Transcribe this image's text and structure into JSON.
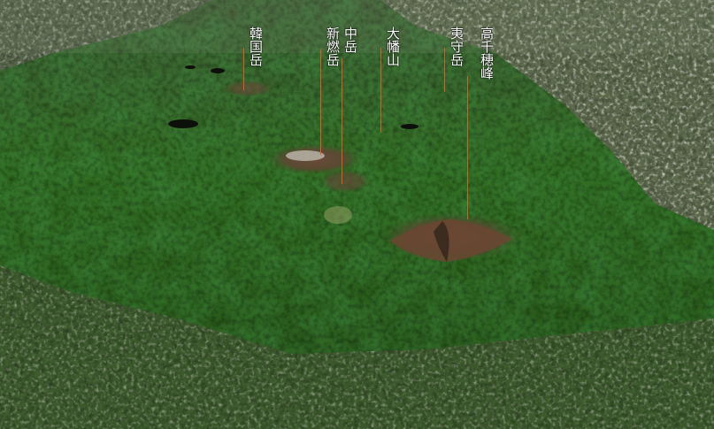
{
  "map": {
    "imagery": "satellite-3d-terrain",
    "colors": {
      "leader_line": "#e25a1c",
      "label_text": "#ffffff",
      "vegetation": "#2f6a1f",
      "urban": "#a8a89a"
    },
    "peaks": [
      {
        "id": "karakunidake",
        "name": "韓国岳"
      },
      {
        "id": "shinmoedake",
        "name": "新燃岳"
      },
      {
        "id": "nakadake",
        "name": "中岳"
      },
      {
        "id": "ohatayama",
        "name": "大幡山"
      },
      {
        "id": "ehinodake",
        "name": "夷守岳"
      },
      {
        "id": "takachiho",
        "name": "高千穂峰"
      }
    ]
  }
}
